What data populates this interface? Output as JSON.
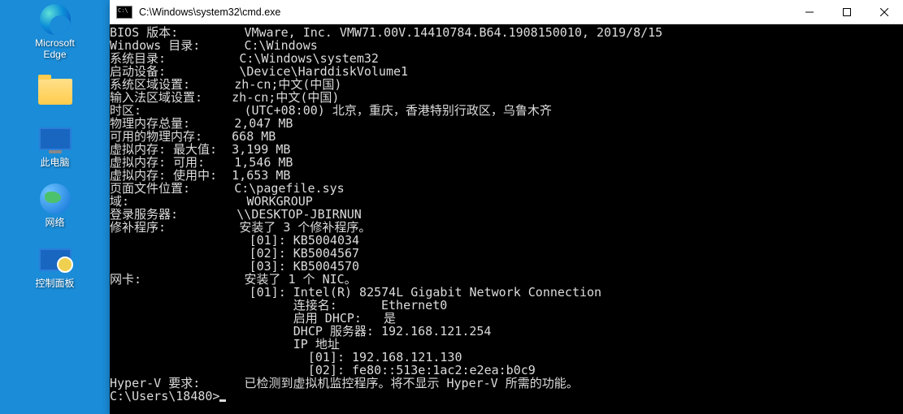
{
  "desktop": {
    "edge": "Microsoft\nEdge",
    "folder": "",
    "this_pc": "此电脑",
    "network": "网络",
    "control_panel": "控制面板"
  },
  "window": {
    "title": "C:\\Windows\\system32\\cmd.exe"
  },
  "terminal": {
    "lines": [
      "BIOS 版本:         VMware, Inc. VMW71.00V.14410784.B64.1908150010, 2019/8/15",
      "Windows 目录:      C:\\Windows",
      "系统目录:          C:\\Windows\\system32",
      "启动设备:          \\Device\\HarddiskVolume1",
      "系统区域设置:      zh-cn;中文(中国)",
      "输入法区域设置:    zh-cn;中文(中国)",
      "时区:              (UTC+08:00) 北京，重庆，香港特别行政区，乌鲁木齐",
      "物理内存总量:      2,047 MB",
      "可用的物理内存:    668 MB",
      "虚拟内存: 最大值:  3,199 MB",
      "虚拟内存: 可用:    1,546 MB",
      "虚拟内存: 使用中:  1,653 MB",
      "页面文件位置:      C:\\pagefile.sys",
      "域:                WORKGROUP",
      "登录服务器:        \\\\DESKTOP-JBIRNUN",
      "修补程序:          安装了 3 个修补程序。",
      "                   [01]: KB5004034",
      "                   [02]: KB5004567",
      "                   [03]: KB5004570",
      "网卡:              安装了 1 个 NIC。",
      "                   [01]: Intel(R) 82574L Gigabit Network Connection",
      "                         连接名:      Ethernet0",
      "                         启用 DHCP:   是",
      "                         DHCP 服务器: 192.168.121.254",
      "                         IP 地址",
      "                           [01]: 192.168.121.130",
      "                           [02]: fe80::513e:1ac2:e2ea:b0c9",
      "Hyper-V 要求:      已检测到虚拟机监控程序。将不显示 Hyper-V 所需的功能。",
      ""
    ],
    "prompt": "C:\\Users\\18480>"
  }
}
